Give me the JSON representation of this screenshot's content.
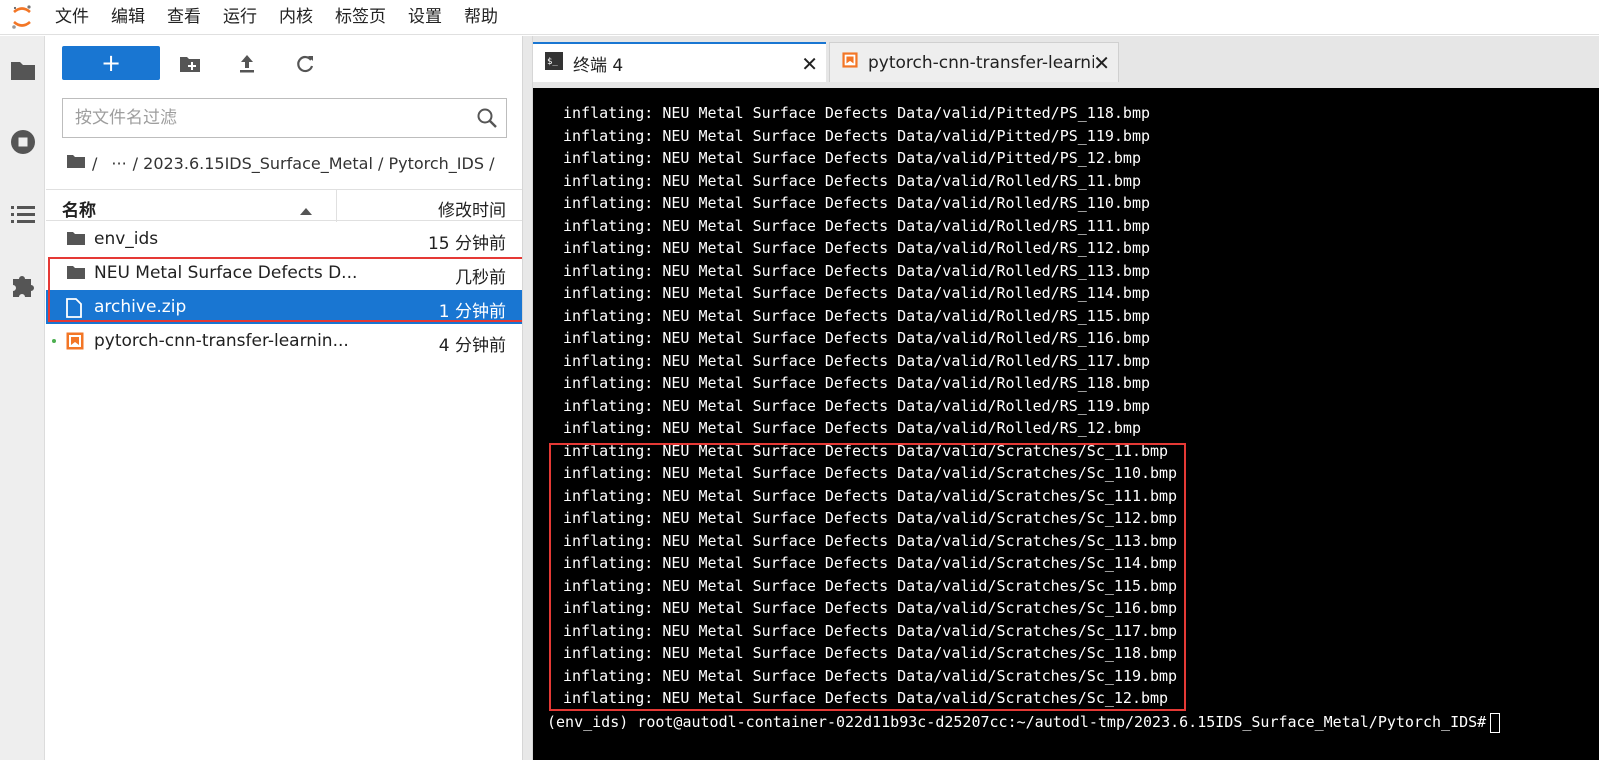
{
  "menubar": {
    "items": [
      "文件",
      "编辑",
      "查看",
      "运行",
      "内核",
      "标签页",
      "设置",
      "帮助"
    ]
  },
  "activity": {
    "icons": [
      "folder-icon",
      "stop-circle-icon",
      "list-icon",
      "puzzle-icon"
    ]
  },
  "filebrowser": {
    "new_button_label": "+",
    "filter_placeholder": "按文件名过滤",
    "breadcrumb": {
      "root": "/",
      "ellipsis": "···",
      "path": "/ 2023.6.15IDS_Surface_Metal / Pytorch_IDS /"
    },
    "columns": {
      "name": "名称",
      "modified": "修改时间"
    },
    "files": [
      {
        "name": "env_ids",
        "modified": "15 分钟前",
        "type": "folder"
      },
      {
        "name": "NEU Metal Surface Defects D...",
        "modified": "几秒前",
        "type": "folder"
      },
      {
        "name": "archive.zip",
        "modified": "1 分钟前",
        "type": "file",
        "selected": true
      },
      {
        "name": "pytorch-cnn-transfer-learnin...",
        "modified": "4 分钟前",
        "type": "notebook",
        "running": true
      }
    ]
  },
  "tabs": [
    {
      "label": "终端 4",
      "icon": "terminal-icon",
      "close": "✕"
    },
    {
      "label": "pytorch-cnn-transfer-learning",
      "icon": "notebook-icon",
      "close": "✕"
    }
  ],
  "terminal": {
    "lines": [
      "inflating: NEU Metal Surface Defects Data/valid/Pitted/PS_118.bmp",
      "inflating: NEU Metal Surface Defects Data/valid/Pitted/PS_119.bmp",
      "inflating: NEU Metal Surface Defects Data/valid/Pitted/PS_12.bmp",
      "inflating: NEU Metal Surface Defects Data/valid/Rolled/RS_11.bmp",
      "inflating: NEU Metal Surface Defects Data/valid/Rolled/RS_110.bmp",
      "inflating: NEU Metal Surface Defects Data/valid/Rolled/RS_111.bmp",
      "inflating: NEU Metal Surface Defects Data/valid/Rolled/RS_112.bmp",
      "inflating: NEU Metal Surface Defects Data/valid/Rolled/RS_113.bmp",
      "inflating: NEU Metal Surface Defects Data/valid/Rolled/RS_114.bmp",
      "inflating: NEU Metal Surface Defects Data/valid/Rolled/RS_115.bmp",
      "inflating: NEU Metal Surface Defects Data/valid/Rolled/RS_116.bmp",
      "inflating: NEU Metal Surface Defects Data/valid/Rolled/RS_117.bmp",
      "inflating: NEU Metal Surface Defects Data/valid/Rolled/RS_118.bmp",
      "inflating: NEU Metal Surface Defects Data/valid/Rolled/RS_119.bmp",
      "inflating: NEU Metal Surface Defects Data/valid/Rolled/RS_12.bmp",
      "inflating: NEU Metal Surface Defects Data/valid/Scratches/Sc_11.bmp",
      "inflating: NEU Metal Surface Defects Data/valid/Scratches/Sc_110.bmp",
      "inflating: NEU Metal Surface Defects Data/valid/Scratches/Sc_111.bmp",
      "inflating: NEU Metal Surface Defects Data/valid/Scratches/Sc_112.bmp",
      "inflating: NEU Metal Surface Defects Data/valid/Scratches/Sc_113.bmp",
      "inflating: NEU Metal Surface Defects Data/valid/Scratches/Sc_114.bmp",
      "inflating: NEU Metal Surface Defects Data/valid/Scratches/Sc_115.bmp",
      "inflating: NEU Metal Surface Defects Data/valid/Scratches/Sc_116.bmp",
      "inflating: NEU Metal Surface Defects Data/valid/Scratches/Sc_117.bmp",
      "inflating: NEU Metal Surface Defects Data/valid/Scratches/Sc_118.bmp",
      "inflating: NEU Metal Surface Defects Data/valid/Scratches/Sc_119.bmp",
      "inflating: NEU Metal Surface Defects Data/valid/Scratches/Sc_12.bmp"
    ],
    "prompt": "(env_ids) root@autodl-container-022d11b93c-d25207cc:~/autodl-tmp/2023.6.15IDS_Surface_Metal/Pytorch_IDS#"
  },
  "colors": {
    "accent": "#1976d2",
    "highlight_box": "#e53935",
    "notebook_icon": "#f37626",
    "running_dot": "#4caf50"
  }
}
